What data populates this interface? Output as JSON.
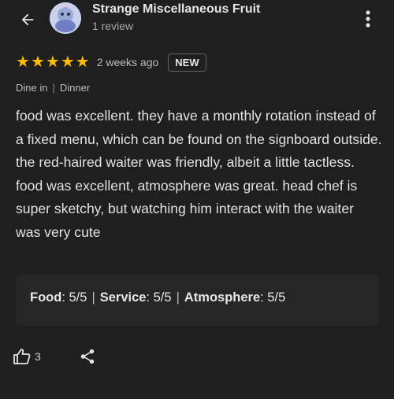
{
  "header": {
    "user_name": "Strange Miscellaneous Fruit",
    "review_count_label": "1 review",
    "back_icon": "arrow-left",
    "more_icon": "vertical-ellipsis"
  },
  "review": {
    "stars": 5,
    "star_glyph": "★",
    "star_color": "#fbbc04",
    "date": "2 weeks ago",
    "badge": "NEW",
    "tags": [
      "Dine in",
      "Dinner"
    ],
    "tag_separator": "|",
    "text": "food was excellent. they have a monthly rotation instead of a fixed menu, which can be found on the signboard outside. the red-haired waiter was friendly, albeit a little tactless. food was excellent, atmosphere was great. head chef is super sketchy, but watching him interact with the waiter was very cute"
  },
  "ratings": {
    "food_label": "Food",
    "food_value": ": 5/5",
    "service_label": "Service",
    "service_value": ": 5/5",
    "atmosphere_label": "Atmosphere",
    "atmosphere_value": ": 5/5",
    "separator": "|"
  },
  "actions": {
    "like_count": "3",
    "like_icon": "thumbs-up",
    "share_icon": "share"
  }
}
